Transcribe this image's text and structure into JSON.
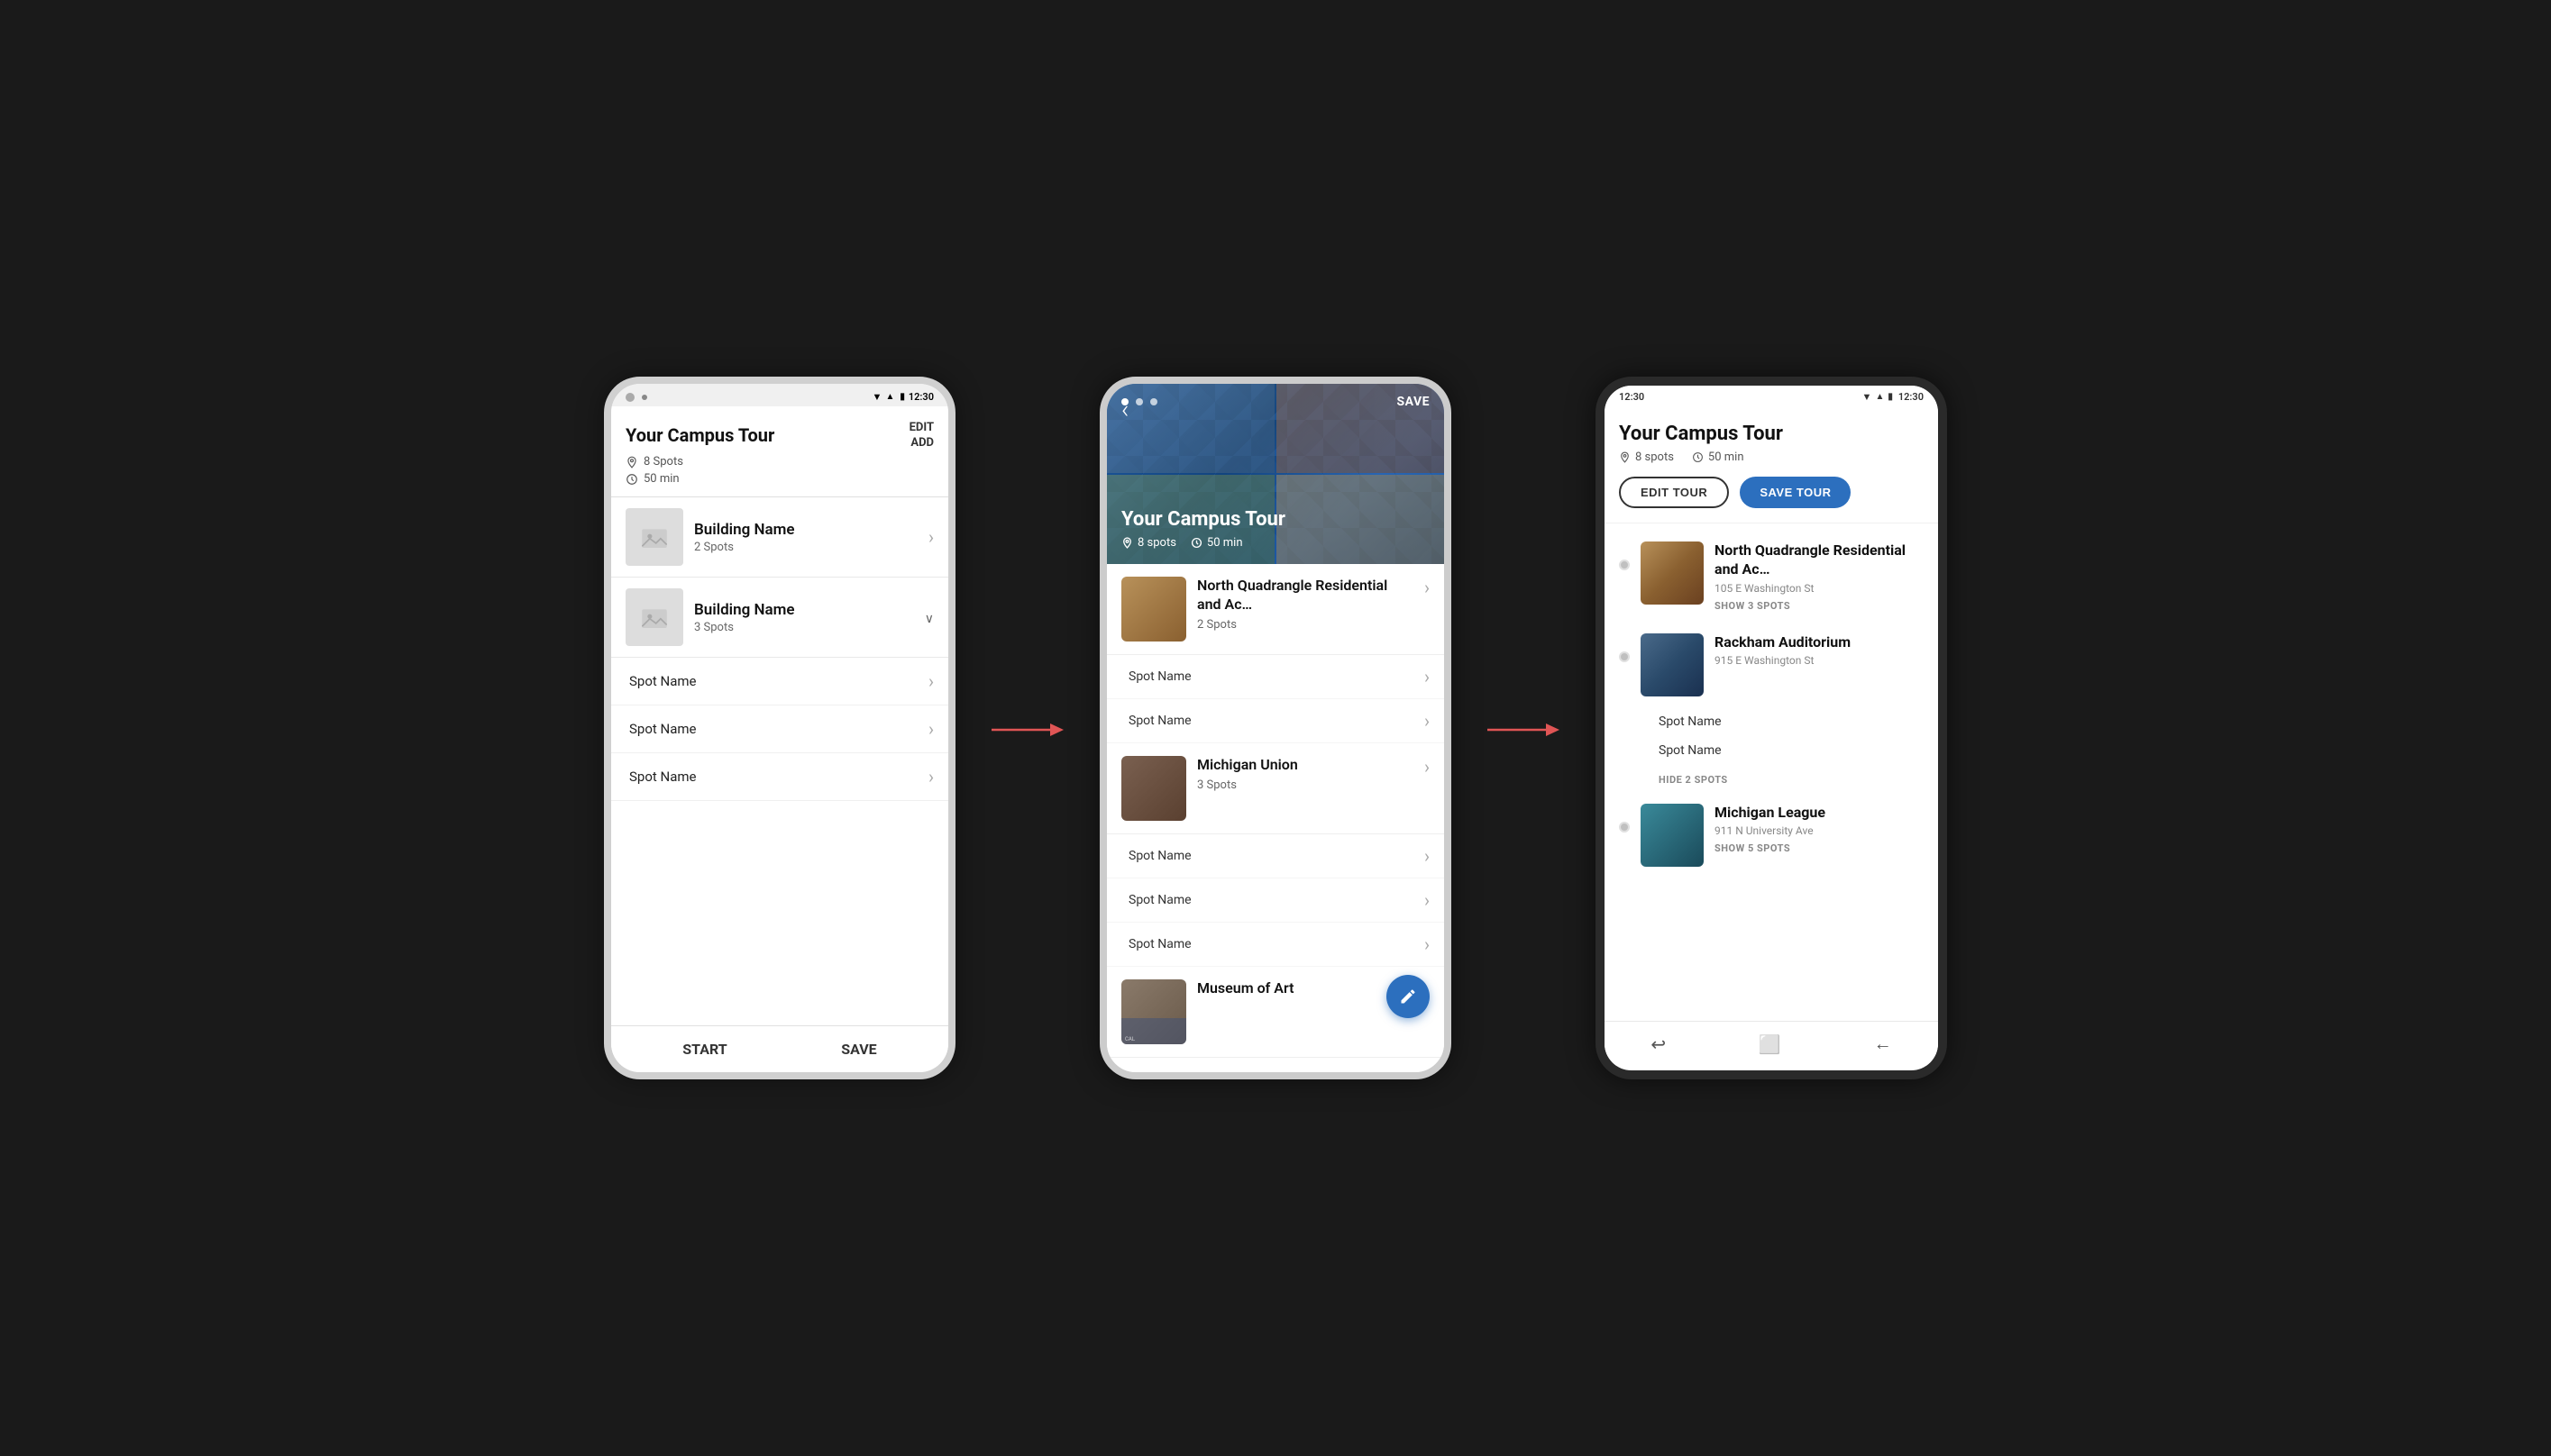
{
  "screen1": {
    "status": {
      "time": "12:30"
    },
    "header": {
      "title": "Your Campus Tour",
      "edit_label": "EDIT",
      "add_label": "ADD",
      "spots": "8 Spots",
      "duration": "50 min"
    },
    "buildings": [
      {
        "name": "Building Name",
        "spots": "2 Spots",
        "expanded": false
      },
      {
        "name": "Building Name",
        "spots": "3 Spots",
        "expanded": true
      }
    ],
    "spots": [
      "Spot Name",
      "Spot Name",
      "Spot Name"
    ],
    "footer": {
      "start_label": "START",
      "save_label": "SAVE"
    }
  },
  "screen2": {
    "status": {
      "time": ""
    },
    "hero": {
      "title": "Your Campus Tour",
      "spots": "8 spots",
      "duration": "50 min",
      "back_label": "‹",
      "save_label": "SAVE"
    },
    "buildings": [
      {
        "name": "North Quadrangle Residential and Ac…",
        "spots_label": "2 Spots",
        "img_class": "s2-building-img-placeholder",
        "spots": [
          "Spot Name",
          "Spot Name"
        ]
      },
      {
        "name": "Michigan Union",
        "spots_label": "3 Spots",
        "img_class": "s2-building-img-union",
        "spots": [
          "Spot Name",
          "Spot Name",
          "Spot Name"
        ]
      },
      {
        "name": "Museum of Art",
        "spots_label": "",
        "img_class": "s2-building-img-museum",
        "spots": []
      }
    ]
  },
  "screen3": {
    "status": {
      "time": "12:30"
    },
    "header": {
      "title": "Your Campus Tour",
      "spots": "8 spots",
      "duration": "50 min",
      "edit_label": "EDIT TOUR",
      "save_label": "SAVE TOUR"
    },
    "buildings": [
      {
        "name": "North Quadrangle Residential and Ac…",
        "address": "105 E Washington St",
        "img_class": "s3-img-northquad",
        "show_spots_label": "SHOW 3 SPOTS",
        "expanded": false,
        "spots": []
      },
      {
        "name": "Rackham Auditorium",
        "address": "915 E Washington St",
        "img_class": "s3-img-rackham",
        "show_spots_label": "HIDE 2 SPOTS",
        "expanded": true,
        "spots": [
          "Spot Name",
          "Spot Name"
        ]
      },
      {
        "name": "Michigan League",
        "address": "911 N University Ave",
        "img_class": "s3-img-league",
        "show_spots_label": "SHOW 5 SPOTS",
        "expanded": false,
        "spots": []
      }
    ],
    "footer": {
      "icons": [
        "↩",
        "⬜",
        "←"
      ]
    }
  },
  "arrows": {
    "label": "→"
  }
}
